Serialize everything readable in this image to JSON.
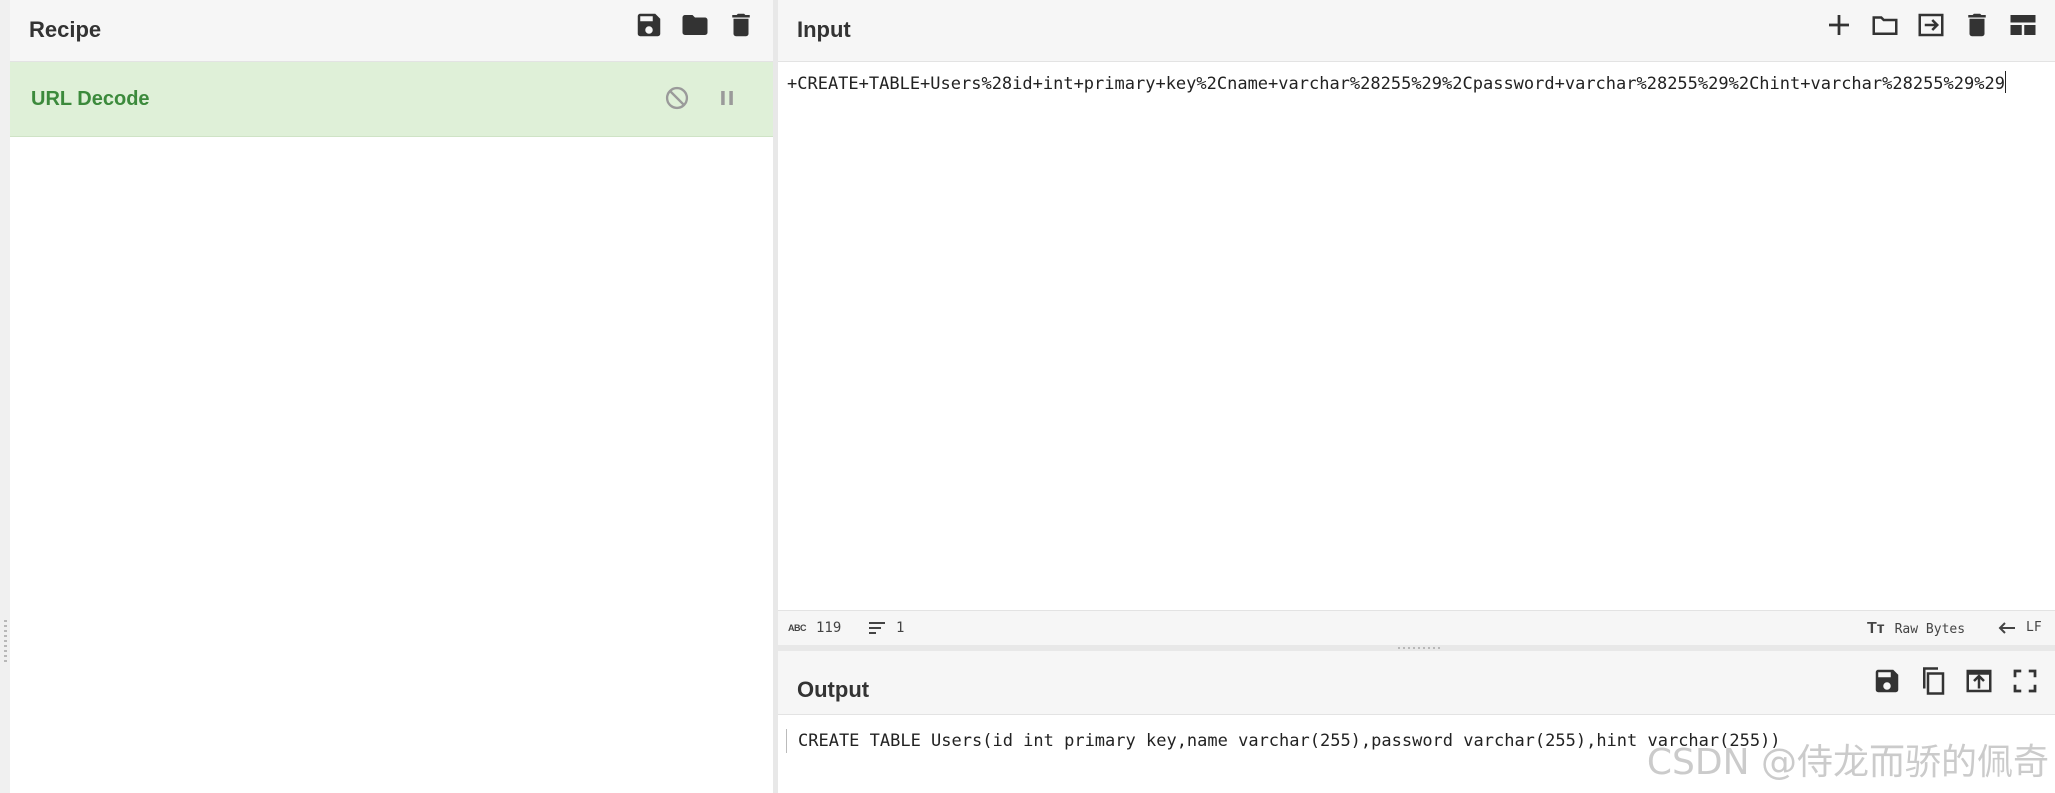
{
  "recipe": {
    "title": "Recipe",
    "icons": [
      "save-icon",
      "folder-icon",
      "trash-icon"
    ],
    "operations": [
      {
        "name": "URL Decode",
        "icons": [
          "disable-icon",
          "pause-icon"
        ]
      }
    ]
  },
  "input": {
    "title": "Input",
    "icons": [
      "plus-icon",
      "folder-icon",
      "import-icon",
      "trash-icon",
      "layout-icon"
    ],
    "text": "+CREATE+TABLE+Users%28id+int+primary+key%2Cname+varchar%28255%29%2Cpassword+varchar%28255%29%2Chint+varchar%28255%29%29",
    "status": {
      "abc_label": "ABC",
      "char_count": "119",
      "line_count": "1",
      "encoding": "Raw Bytes",
      "eol": "LF"
    }
  },
  "output": {
    "title": "Output",
    "icons": [
      "save-icon",
      "copy-icon",
      "replace-input-icon",
      "fullscreen-icon"
    ],
    "text": "CREATE TABLE Users(id int primary key,name varchar(255),password varchar(255),hint varchar(255))"
  },
  "watermark": "CSDN @侍龙而骄的佩奇",
  "colors": {
    "accent_green": "#3c8a3c",
    "operation_bg": "#dff0d8",
    "header_bg": "#f6f6f6"
  }
}
